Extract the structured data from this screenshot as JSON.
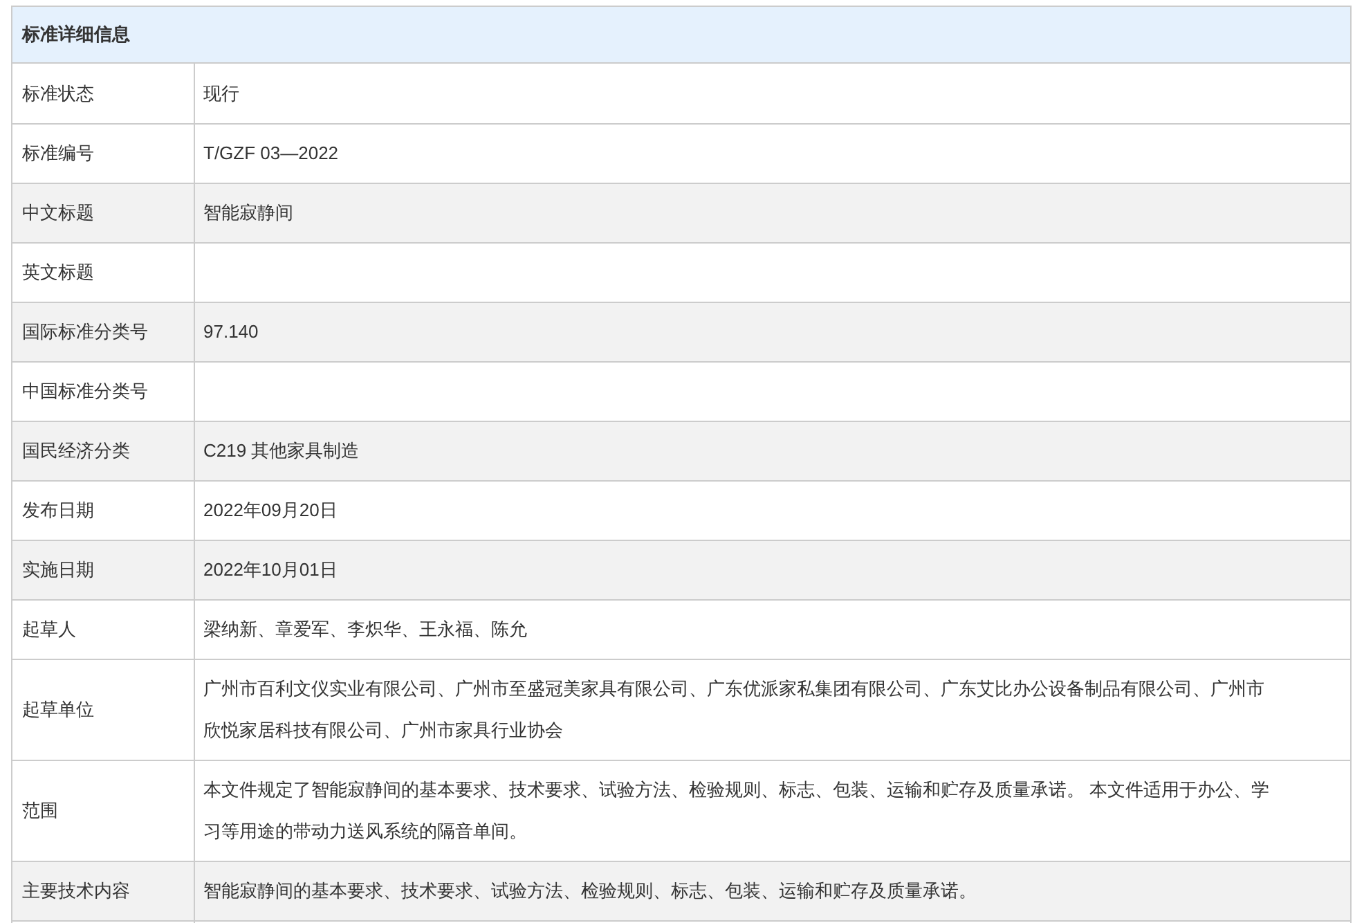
{
  "table": {
    "title": "标准详细信息",
    "rows": [
      {
        "label": "标准状态",
        "value": "现行",
        "shaded": false
      },
      {
        "label": "标准编号",
        "value": "T/GZF 03—2022",
        "shaded": false
      },
      {
        "label": "中文标题",
        "value": "智能寂静间",
        "shaded": true
      },
      {
        "label": "英文标题",
        "shaded": false
      },
      {
        "label": "国际标准分类号",
        "value": "97.140",
        "shaded": true
      },
      {
        "label": "中国标准分类号",
        "shaded": false
      },
      {
        "label": "国民经济分类",
        "value": "C219 其他家具制造",
        "shaded": true
      },
      {
        "label": "发布日期",
        "value": "2022年09月20日",
        "shaded": false
      },
      {
        "label": "实施日期",
        "value": "2022年10月01日",
        "shaded": true
      },
      {
        "label": "起草人",
        "value": "梁纳新、章爱军、李炽华、王永福、陈允",
        "shaded": false
      },
      {
        "label": "起草单位",
        "value": "广州市百利文仪实业有限公司、广州市至盛冠美家具有限公司、广东优派家私集团有限公司、广东艾比办公设备制品有限公司、广州市欣悦家居科技有限公司、广州市家具行业协会",
        "shaded": false
      },
      {
        "label": "范围",
        "value": "本文件规定了智能寂静间的基本要求、技术要求、试验方法、检验规则、标志、包装、运输和贮存及质量承诺。 本文件适用于办公、学习等用途的带动力送风系统的隔音单间。",
        "shaded": false
      },
      {
        "label": "主要技术内容",
        "value": "智能寂静间的基本要求、技术要求、试验方法、检验规则、标志、包装、运输和贮存及质量承诺。",
        "shaded": true
      }
    ]
  }
}
